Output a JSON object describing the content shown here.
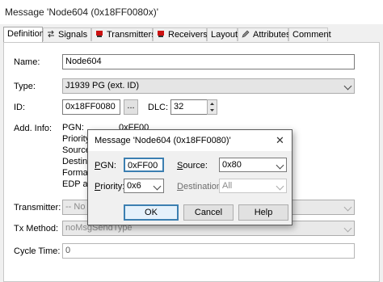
{
  "window": {
    "title": "Message 'Node604 (0x18FF0080x)'",
    "tabs": [
      {
        "label": "Definition",
        "icon": "none"
      },
      {
        "label": "Signals",
        "icon": "signal-arrows-icon"
      },
      {
        "label": "Transmitters",
        "icon": "ecu-red-icon"
      },
      {
        "label": "Receivers",
        "icon": "ecu-red-icon"
      },
      {
        "label": "Layout",
        "icon": "none"
      },
      {
        "label": "Attributes",
        "icon": "pen-icon"
      },
      {
        "label": "Comment",
        "icon": "none"
      }
    ]
  },
  "definition": {
    "name_label": "Name:",
    "name_value": "Node604",
    "type_label": "Type:",
    "type_value": "J1939 PG (ext. ID)",
    "id_label": "ID:",
    "id_value": "0x18FF0080",
    "id_browse": "...",
    "dlc_label": "DLC:",
    "dlc_value": "32",
    "addinfo_label": "Add. Info:",
    "addinfo": {
      "pgn_label": "PGN:",
      "pgn_value": "0xFF00",
      "priority_label": "Priority:",
      "source_label": "Source:",
      "destination_label": "Destina",
      "format_label": "Format:",
      "edp_label": "EDP an"
    },
    "transmitter_label": "Transmitter:",
    "transmitter_value": "-- No Tr",
    "txmethod_label": "Tx Method:",
    "txmethod_value": "noMsgSendType",
    "cycletime_label": "Cycle Time:",
    "cycletime_value": "0"
  },
  "dialog": {
    "title": "Message 'Node604 (0x18FF0080)'",
    "close_glyph": "✕",
    "pgn_label_u": "P",
    "pgn_label_rest": "GN:",
    "pgn_value": "0xFF00",
    "source_label_u": "S",
    "source_label_rest": "ource:",
    "source_value": "0x80",
    "priority_label_u": "P",
    "priority_label_rest": "riority:",
    "priority_value": "0x6",
    "destination_label_u": "D",
    "destination_label_rest": "estination:",
    "destination_value": "All",
    "ok": "OK",
    "cancel": "Cancel",
    "help": "Help"
  },
  "colors": {
    "focus_border": "#3c7fb1",
    "ecu_icon": "#cc1111"
  }
}
